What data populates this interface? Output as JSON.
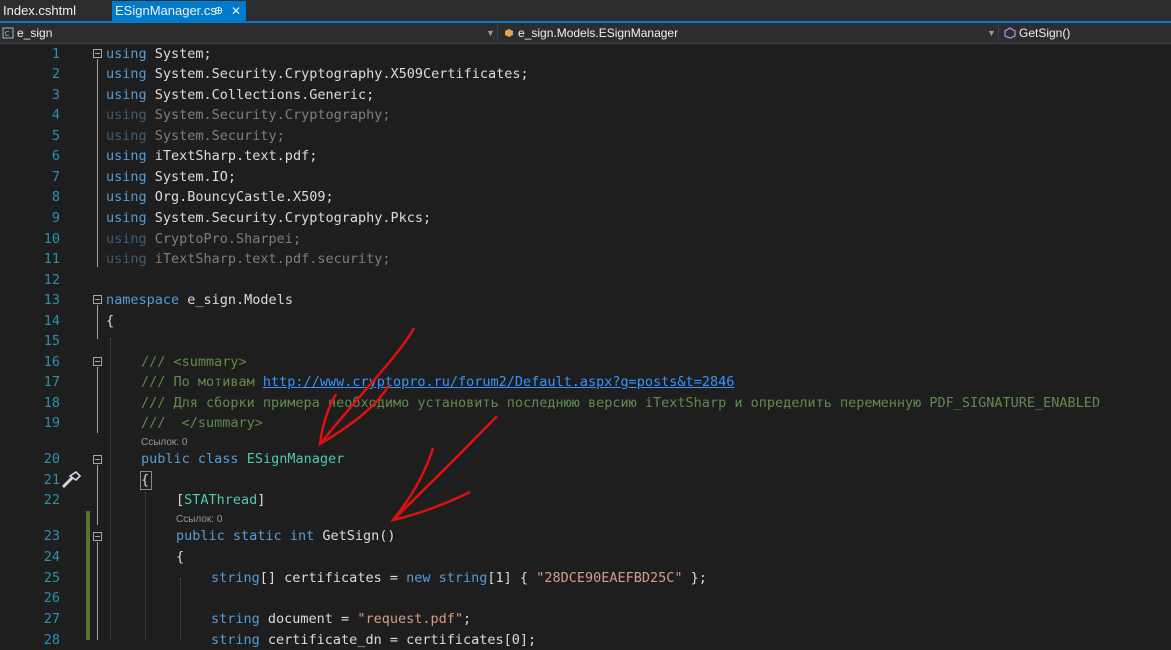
{
  "tabs": [
    {
      "label": "Index.cshtml"
    },
    {
      "label": "ESignManager.cs",
      "pin": "⊕",
      "close": "✕"
    }
  ],
  "navbar": {
    "project": "e_sign",
    "type": "e_sign.Models.ESignManager",
    "member": "GetSign()"
  },
  "code": {
    "l1": "1",
    "l2": "2",
    "l3": "3",
    "l4": "4",
    "l5": "5",
    "l6": "6",
    "l7": "7",
    "l8": "8",
    "l9": "9",
    "l10": "10",
    "l11": "11",
    "l12": "12",
    "l13": "13",
    "l14": "14",
    "l15": "15",
    "l16": "16",
    "l17": "17",
    "l18": "18",
    "l19": "19",
    "l20": "20",
    "l21": "21",
    "l22": "22",
    "l23": "23",
    "l24": "24",
    "l25": "25",
    "l26": "26",
    "l27": "27",
    "l28": "28",
    "kw_using": "using",
    "u1": " System;",
    "u2": " System.Security.Cryptography.X509Certificates;",
    "u3": " System.Collections.Generic;",
    "u4": " System.Security.Cryptography;",
    "u5": " System.Security;",
    "u6": " iTextSharp.text.pdf;",
    "u7": " System.IO;",
    "u8": " Org.BouncyCastle.X509;",
    "u9": " System.Security.Cryptography.Pkcs;",
    "u10": " CryptoPro.Sharpei;",
    "u11": " iTextSharp.text.pdf.security;",
    "kw_namespace": "namespace",
    "ns": " e_sign.Models",
    "brace_open": "{",
    "c16": "/// <summary>",
    "c17a": "/// По мотивам ",
    "c17link": "http://www.cryptopro.ru/forum2/Default.aspx?g=posts&t=2846",
    "c18": "/// Для сборки примера необходимо установить последнюю версию iTextSharp и определить переменную PDF_SIGNATURE_ENABLED",
    "c19": "///  </summary>",
    "ref0": "Ссылок: 0",
    "kw_public": "public",
    "kw_class": "class",
    "cls": "ESignManager",
    "attr_open": "[",
    "attr": "STAThread",
    "attr_close": "]",
    "kw_static": "static",
    "kw_int": "int",
    "method": " GetSign()",
    "kw_string": "string",
    "l25_mid": "[] certificates = ",
    "kw_new": "new",
    "l25_mid2": "[1] { ",
    "str_cert": "\"28DCE90EAEFBD25C\"",
    "l25_end": " };",
    "l27_mid": " document = ",
    "str_doc": "\"request.pdf\"",
    "semi": ";",
    "l28_mid": " certificate_dn = certificates[0];"
  }
}
